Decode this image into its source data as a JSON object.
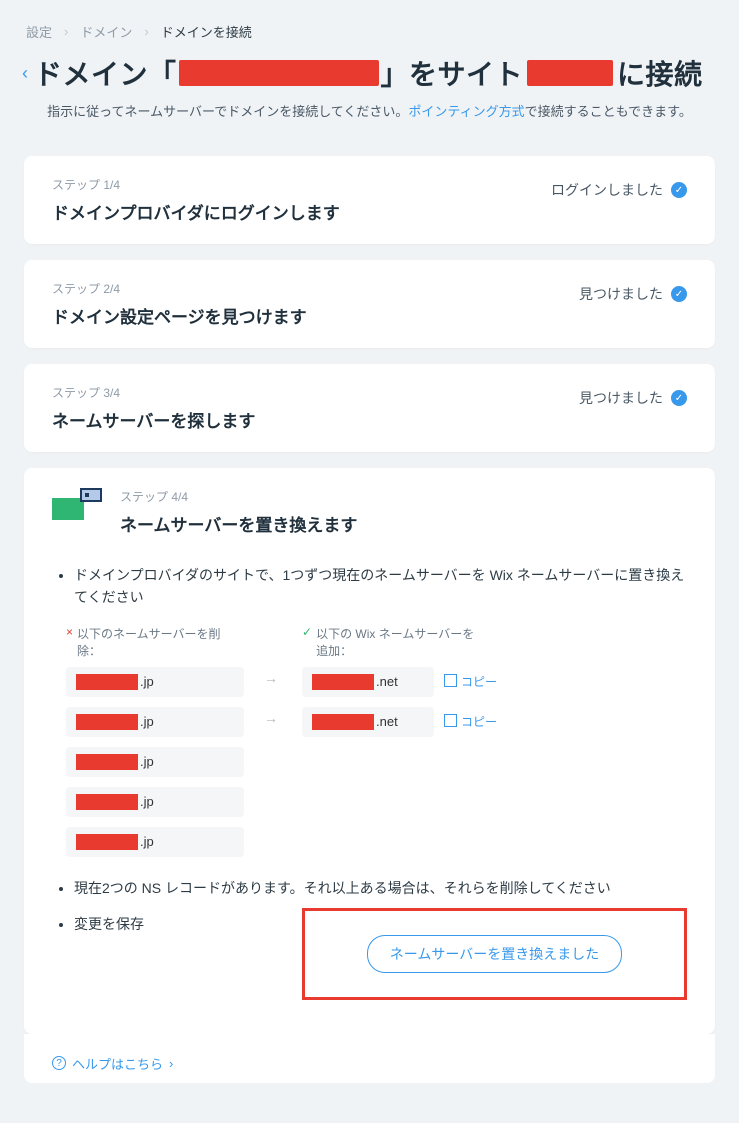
{
  "breadcrumb": {
    "a": "設定",
    "b": "ドメイン",
    "c": "ドメインを接続"
  },
  "title": {
    "pre": "ドメイン「",
    "mid1": "」をサイト",
    "mid2": "に接続"
  },
  "subtitle": {
    "pre": "指示に従ってネームサーバーでドメインを接続してください。",
    "link": "ポインティング方式",
    "post": "で接続することもできます。"
  },
  "steps": [
    {
      "n": "ステップ 1/4",
      "title": "ドメインプロバイダにログインします",
      "status": "ログインしました"
    },
    {
      "n": "ステップ 2/4",
      "title": "ドメイン設定ページを見つけます",
      "status": "見つけました"
    },
    {
      "n": "ステップ 3/4",
      "title": "ネームサーバーを探します",
      "status": "見つけました"
    }
  ],
  "step4": {
    "n": "ステップ 4/4",
    "title": "ネームサーバーを置き換えます",
    "bullet1": "ドメインプロバイダのサイトで、1つずつ現在のネームサーバーを Wix ネームサーバーに置き換えてください",
    "remove_label": "以下のネームサーバーを削除：",
    "add_label": "以下の Wix ネームサーバーを追加：",
    "remove_suffix": [
      ".jp",
      ".jp",
      ".jp",
      ".jp",
      ".jp"
    ],
    "add_suffix": [
      ".net",
      ".net"
    ],
    "copy_label": "コピー",
    "bullet2": "現在2つの NS レコードがあります。それ以上ある場合は、それらを削除してください",
    "bullet3": "変更を保存",
    "action": "ネームサーバーを置き換えました"
  },
  "help": "ヘルプはこちら"
}
